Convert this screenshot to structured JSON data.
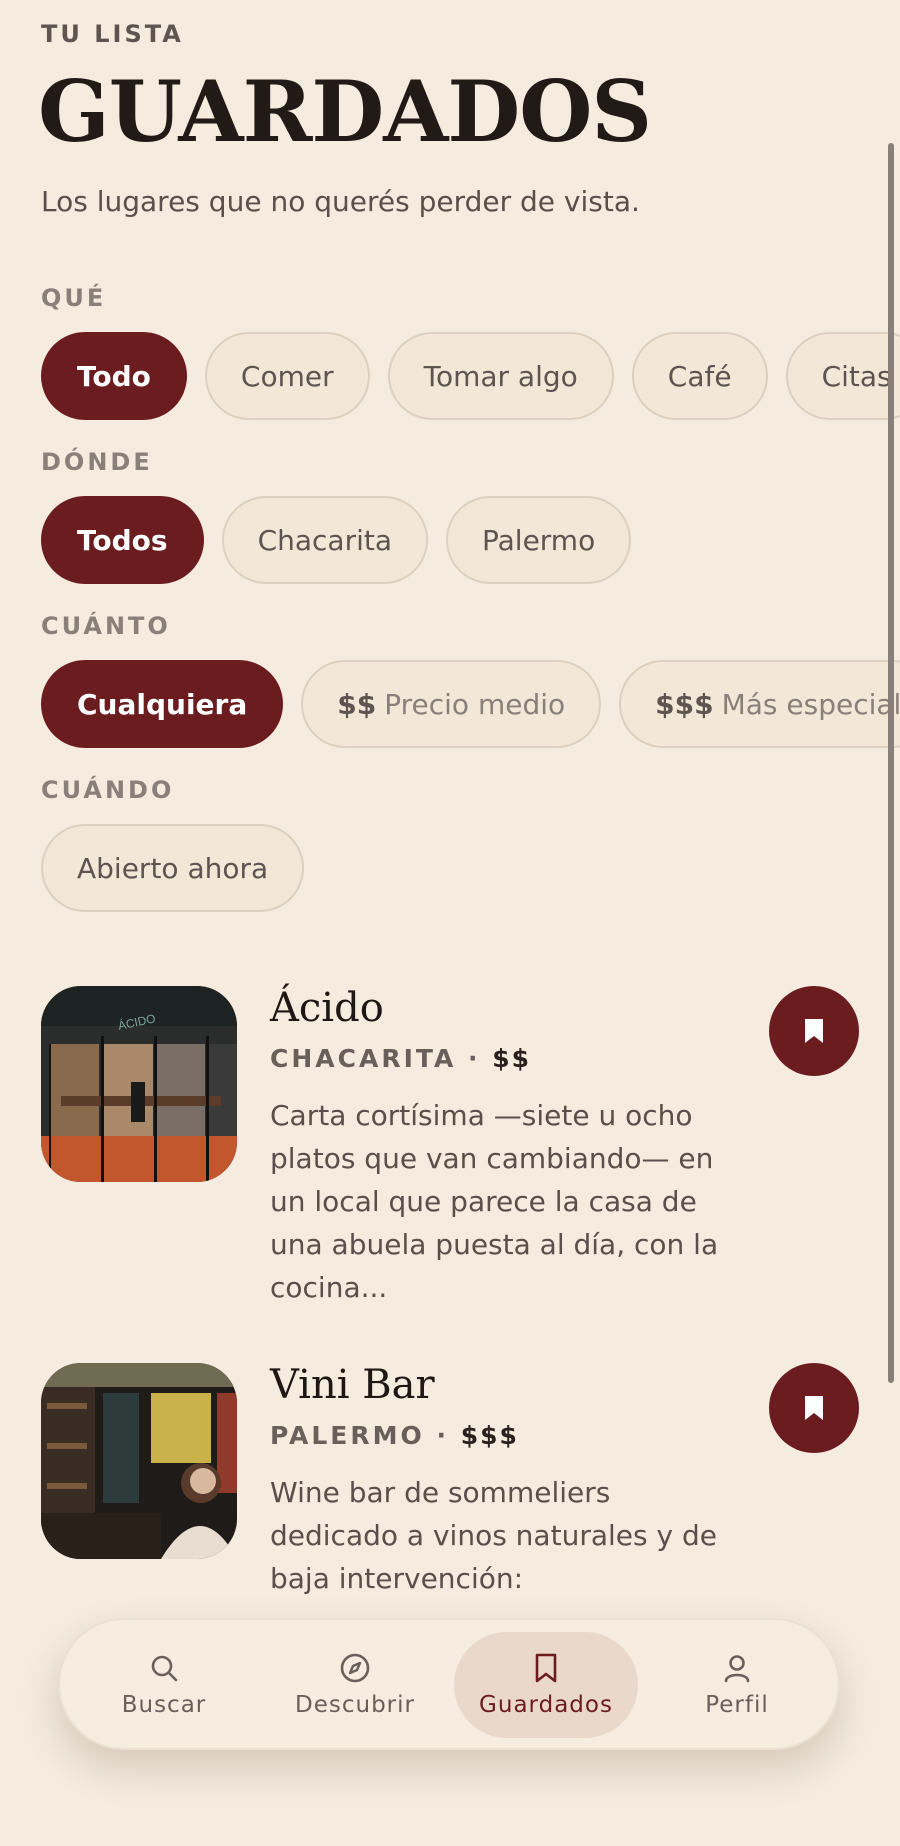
{
  "header": {
    "eyebrow": "TU LISTA",
    "title": "GUARDADOS",
    "subtitle": "Los lugares que no querés perder de vista."
  },
  "filters": {
    "que": {
      "label": "QUÉ",
      "options": [
        "Todo",
        "Comer",
        "Tomar algo",
        "Café",
        "Citas"
      ],
      "selected": "Todo"
    },
    "donde": {
      "label": "DÓNDE",
      "options": [
        "Todos",
        "Chacarita",
        "Palermo"
      ],
      "selected": "Todos"
    },
    "cuanto": {
      "label": "CUÁNTO",
      "selected_label": "Cualquiera",
      "options": [
        {
          "symbol": "$$",
          "text": "Precio medio"
        },
        {
          "symbol": "$$$",
          "text": "Más especial"
        }
      ]
    },
    "cuando": {
      "label": "CUÁNDO",
      "options": [
        "Abierto ahora"
      ]
    }
  },
  "places": [
    {
      "name": "Ácido",
      "neighborhood": "CHACARITA",
      "separator": "·",
      "price": "$$",
      "description": "Carta cortísima —siete u ocho platos que van cambiando— en un local que parece la casa de una abuela puesta al día, con la cocina...",
      "sign_text": "ÁCIDO"
    },
    {
      "name": "Vini Bar",
      "neighborhood": "PALERMO",
      "separator": "·",
      "price": "$$$",
      "description": "Wine bar de sommeliers dedicado a vinos naturales y de baja intervención:"
    }
  ],
  "nav": {
    "items": [
      {
        "label": "Buscar",
        "icon": "search-icon"
      },
      {
        "label": "Descubrir",
        "icon": "compass-icon"
      },
      {
        "label": "Guardados",
        "icon": "bookmark-icon",
        "active": true
      },
      {
        "label": "Perfil",
        "icon": "person-icon"
      }
    ]
  },
  "colors": {
    "background": "#f5ebdf",
    "accent": "#6b1c1f",
    "chip_bg": "#f3e7d7",
    "text_dark": "#221a16"
  }
}
